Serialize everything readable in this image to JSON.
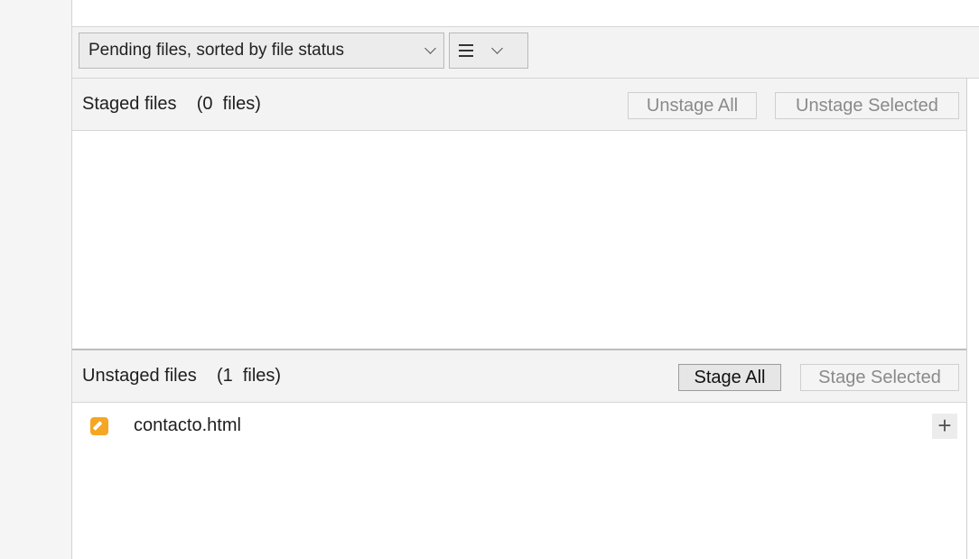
{
  "toolbar": {
    "sort_dropdown_label": "Pending files, sorted by file status",
    "view_dropdown_icon": "list-lines-icon"
  },
  "staged": {
    "title": "Staged files    (0  files)",
    "unstage_all_label": "Unstage All",
    "unstage_selected_label": "Unstage Selected",
    "files": []
  },
  "unstaged": {
    "title": "Unstaged files    (1  files)",
    "stage_all_label": "Stage All",
    "stage_selected_label": "Stage Selected",
    "files": [
      {
        "name": "contacto.html",
        "status_icon": "modified-pencil-icon",
        "status_color": "#f5a623",
        "action": "+"
      }
    ]
  },
  "colors": {
    "modified": "#f5a623",
    "header_bg": "#f3f3f3",
    "disabled_text": "#8a8a8a"
  }
}
